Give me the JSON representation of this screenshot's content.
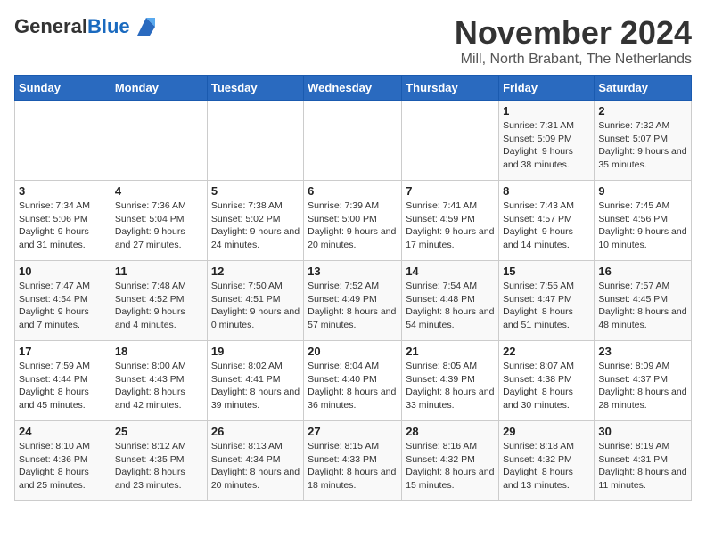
{
  "logo": {
    "general": "General",
    "blue": "Blue"
  },
  "header": {
    "month_title": "November 2024",
    "subtitle": "Mill, North Brabant, The Netherlands"
  },
  "days_of_week": [
    "Sunday",
    "Monday",
    "Tuesday",
    "Wednesday",
    "Thursday",
    "Friday",
    "Saturday"
  ],
  "weeks": [
    [
      {
        "day": "",
        "info": ""
      },
      {
        "day": "",
        "info": ""
      },
      {
        "day": "",
        "info": ""
      },
      {
        "day": "",
        "info": ""
      },
      {
        "day": "",
        "info": ""
      },
      {
        "day": "1",
        "info": "Sunrise: 7:31 AM\nSunset: 5:09 PM\nDaylight: 9 hours and 38 minutes."
      },
      {
        "day": "2",
        "info": "Sunrise: 7:32 AM\nSunset: 5:07 PM\nDaylight: 9 hours and 35 minutes."
      }
    ],
    [
      {
        "day": "3",
        "info": "Sunrise: 7:34 AM\nSunset: 5:06 PM\nDaylight: 9 hours and 31 minutes."
      },
      {
        "day": "4",
        "info": "Sunrise: 7:36 AM\nSunset: 5:04 PM\nDaylight: 9 hours and 27 minutes."
      },
      {
        "day": "5",
        "info": "Sunrise: 7:38 AM\nSunset: 5:02 PM\nDaylight: 9 hours and 24 minutes."
      },
      {
        "day": "6",
        "info": "Sunrise: 7:39 AM\nSunset: 5:00 PM\nDaylight: 9 hours and 20 minutes."
      },
      {
        "day": "7",
        "info": "Sunrise: 7:41 AM\nSunset: 4:59 PM\nDaylight: 9 hours and 17 minutes."
      },
      {
        "day": "8",
        "info": "Sunrise: 7:43 AM\nSunset: 4:57 PM\nDaylight: 9 hours and 14 minutes."
      },
      {
        "day": "9",
        "info": "Sunrise: 7:45 AM\nSunset: 4:56 PM\nDaylight: 9 hours and 10 minutes."
      }
    ],
    [
      {
        "day": "10",
        "info": "Sunrise: 7:47 AM\nSunset: 4:54 PM\nDaylight: 9 hours and 7 minutes."
      },
      {
        "day": "11",
        "info": "Sunrise: 7:48 AM\nSunset: 4:52 PM\nDaylight: 9 hours and 4 minutes."
      },
      {
        "day": "12",
        "info": "Sunrise: 7:50 AM\nSunset: 4:51 PM\nDaylight: 9 hours and 0 minutes."
      },
      {
        "day": "13",
        "info": "Sunrise: 7:52 AM\nSunset: 4:49 PM\nDaylight: 8 hours and 57 minutes."
      },
      {
        "day": "14",
        "info": "Sunrise: 7:54 AM\nSunset: 4:48 PM\nDaylight: 8 hours and 54 minutes."
      },
      {
        "day": "15",
        "info": "Sunrise: 7:55 AM\nSunset: 4:47 PM\nDaylight: 8 hours and 51 minutes."
      },
      {
        "day": "16",
        "info": "Sunrise: 7:57 AM\nSunset: 4:45 PM\nDaylight: 8 hours and 48 minutes."
      }
    ],
    [
      {
        "day": "17",
        "info": "Sunrise: 7:59 AM\nSunset: 4:44 PM\nDaylight: 8 hours and 45 minutes."
      },
      {
        "day": "18",
        "info": "Sunrise: 8:00 AM\nSunset: 4:43 PM\nDaylight: 8 hours and 42 minutes."
      },
      {
        "day": "19",
        "info": "Sunrise: 8:02 AM\nSunset: 4:41 PM\nDaylight: 8 hours and 39 minutes."
      },
      {
        "day": "20",
        "info": "Sunrise: 8:04 AM\nSunset: 4:40 PM\nDaylight: 8 hours and 36 minutes."
      },
      {
        "day": "21",
        "info": "Sunrise: 8:05 AM\nSunset: 4:39 PM\nDaylight: 8 hours and 33 minutes."
      },
      {
        "day": "22",
        "info": "Sunrise: 8:07 AM\nSunset: 4:38 PM\nDaylight: 8 hours and 30 minutes."
      },
      {
        "day": "23",
        "info": "Sunrise: 8:09 AM\nSunset: 4:37 PM\nDaylight: 8 hours and 28 minutes."
      }
    ],
    [
      {
        "day": "24",
        "info": "Sunrise: 8:10 AM\nSunset: 4:36 PM\nDaylight: 8 hours and 25 minutes."
      },
      {
        "day": "25",
        "info": "Sunrise: 8:12 AM\nSunset: 4:35 PM\nDaylight: 8 hours and 23 minutes."
      },
      {
        "day": "26",
        "info": "Sunrise: 8:13 AM\nSunset: 4:34 PM\nDaylight: 8 hours and 20 minutes."
      },
      {
        "day": "27",
        "info": "Sunrise: 8:15 AM\nSunset: 4:33 PM\nDaylight: 8 hours and 18 minutes."
      },
      {
        "day": "28",
        "info": "Sunrise: 8:16 AM\nSunset: 4:32 PM\nDaylight: 8 hours and 15 minutes."
      },
      {
        "day": "29",
        "info": "Sunrise: 8:18 AM\nSunset: 4:32 PM\nDaylight: 8 hours and 13 minutes."
      },
      {
        "day": "30",
        "info": "Sunrise: 8:19 AM\nSunset: 4:31 PM\nDaylight: 8 hours and 11 minutes."
      }
    ]
  ]
}
